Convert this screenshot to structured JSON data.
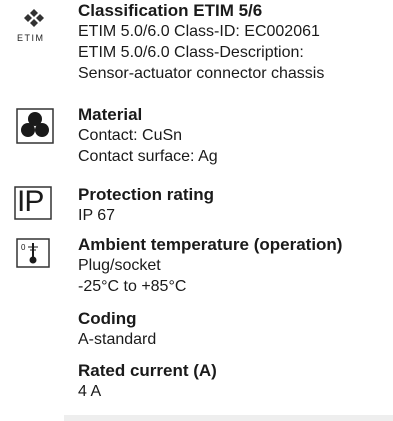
{
  "sections": [
    {
      "icon": "etim-logo-icon",
      "icon_text": "ETIM",
      "title": "Classification ETIM 5/6",
      "lines": [
        "ETIM 5.0/6.0 Class-ID: EC002061",
        "ETIM 5.0/6.0 Class-Description:",
        "Sensor-actuator connector chassis"
      ]
    },
    {
      "icon": "material-icon",
      "title": "Material",
      "lines": [
        "Contact: CuSn",
        "Contact surface: Ag"
      ]
    },
    {
      "icon": "ip-rating-icon",
      "icon_text": "IP",
      "title": "Protection rating",
      "lines": [
        "IP 67"
      ]
    },
    {
      "icon": "thermometer-icon",
      "title": "Ambient temperature (operation)",
      "lines": [
        "Plug/socket",
        "-25°C to +85°C"
      ]
    },
    {
      "icon": "",
      "title": "Coding",
      "lines": [
        "A-standard"
      ]
    },
    {
      "icon": "",
      "title": "Rated current (A)",
      "lines": [
        "4 A"
      ]
    }
  ]
}
